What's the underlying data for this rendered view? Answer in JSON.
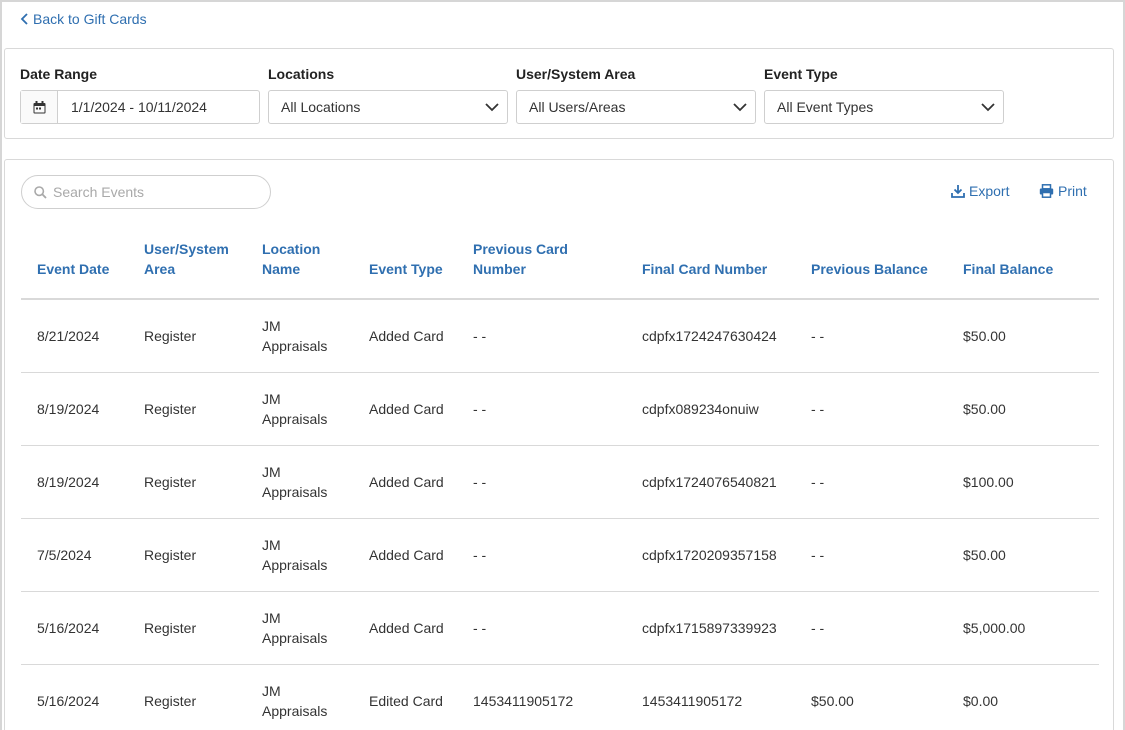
{
  "back_link": "Back to Gift Cards",
  "filters": {
    "date_range": {
      "label": "Date Range",
      "value": "1/1/2024 - 10/11/2024"
    },
    "locations": {
      "label": "Locations",
      "value": "All Locations"
    },
    "user_area": {
      "label": "User/System Area",
      "value": "All Users/Areas"
    },
    "event_type": {
      "label": "Event Type",
      "value": "All Event Types"
    }
  },
  "search": {
    "placeholder": "Search Events"
  },
  "actions": {
    "export": "Export",
    "print": "Print"
  },
  "table": {
    "headers": [
      "Event Date",
      "User/System Area",
      "Location Name",
      "Event Type",
      "Previous Card Number",
      "Final Card Number",
      "Previous Balance",
      "Final Balance"
    ],
    "rows": [
      [
        "8/21/2024",
        "Register",
        "JM Appraisals",
        "Added Card",
        "- -",
        "cdpfx1724247630424",
        "- -",
        "$50.00"
      ],
      [
        "8/19/2024",
        "Register",
        "JM Appraisals",
        "Added Card",
        "- -",
        "cdpfx089234onuiw",
        "- -",
        "$50.00"
      ],
      [
        "8/19/2024",
        "Register",
        "JM Appraisals",
        "Added Card",
        "- -",
        "cdpfx1724076540821",
        "- -",
        "$100.00"
      ],
      [
        "7/5/2024",
        "Register",
        "JM Appraisals",
        "Added Card",
        "- -",
        "cdpfx1720209357158",
        "- -",
        "$50.00"
      ],
      [
        "5/16/2024",
        "Register",
        "JM Appraisals",
        "Added Card",
        "- -",
        "cdpfx1715897339923",
        "- -",
        "$5,000.00"
      ],
      [
        "5/16/2024",
        "Register",
        "JM Appraisals",
        "Edited Card",
        "1453411905172",
        "1453411905172",
        "$50.00",
        "$0.00"
      ]
    ]
  },
  "colors": {
    "accent": "#2f6fb0",
    "border": "#d9d9d9"
  }
}
